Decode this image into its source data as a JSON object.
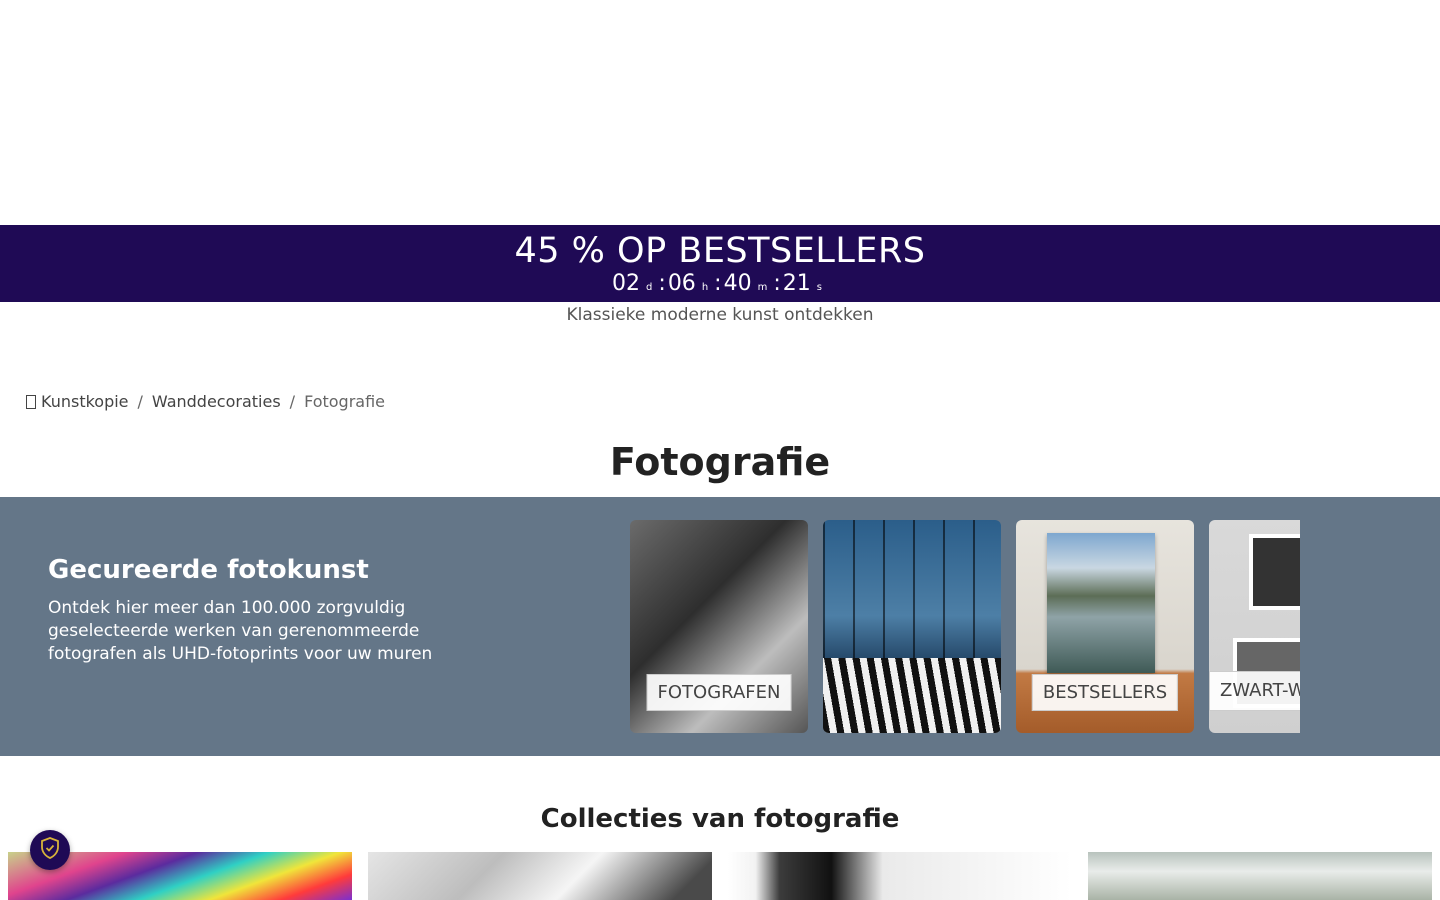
{
  "promo": {
    "title": "45 % OP BESTSELLERS",
    "countdown": {
      "days": "02",
      "days_unit": "d",
      "hours": "06",
      "hours_unit": "h",
      "minutes": "40",
      "minutes_unit": "m",
      "seconds": "21",
      "seconds_unit": "s"
    }
  },
  "subtitle": "Klassieke moderne kunst ontdekken",
  "breadcrumb": {
    "home_icon": "",
    "items": [
      "Kunstkopie",
      "Wanddecoraties",
      "Fotografie"
    ],
    "separator": "/"
  },
  "page_title": "Fotografie",
  "hero": {
    "heading": "Gecureerde fotokunst",
    "text": "Ontdek hier meer dan 100.000 zorgvuldig geselecteerde werken van gerenommeerde fotografen als UHD-fotoprints voor uw muren",
    "cards": [
      {
        "label": "FOTOGRAFEN"
      },
      {
        "label": ""
      },
      {
        "label": "BESTSELLERS"
      },
      {
        "label": "ZWART-WITFOTOGRAFIE"
      }
    ]
  },
  "collections": {
    "title": "Collecties van fotografie"
  },
  "colors": {
    "promo_bg": "#1f0a55",
    "hero_bg": "#647688",
    "privacy_badge": "#1f0a55"
  },
  "icons": {
    "home": "home-icon",
    "privacy": "shield-check-icon"
  }
}
